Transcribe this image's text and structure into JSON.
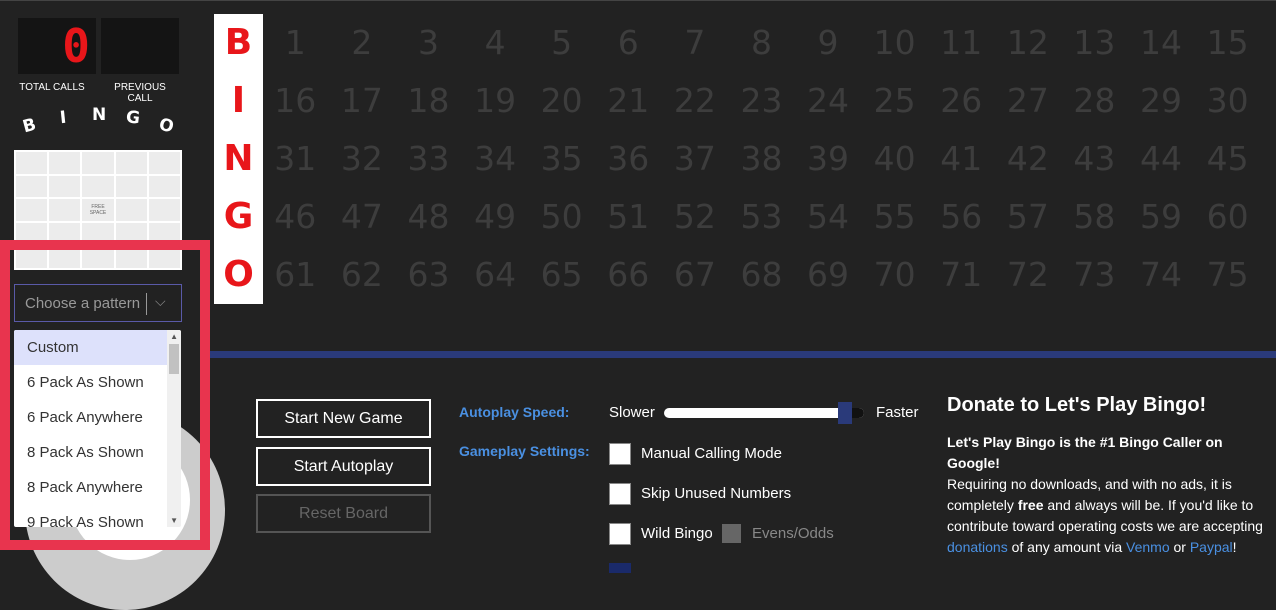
{
  "counters": {
    "total_value": "0",
    "total_label": "TOTAL CALLS",
    "previous_value": "",
    "previous_label": "PREVIOUS CALL"
  },
  "bingo_letters": [
    "B",
    "I",
    "N",
    "G",
    "O"
  ],
  "card": {
    "free_space": "FREE SPACE"
  },
  "pattern_select": {
    "placeholder": "Choose a pattern",
    "options": [
      "Custom",
      "6 Pack As Shown",
      "6 Pack Anywhere",
      "8 Pack As Shown",
      "8 Pack Anywhere",
      "9 Pack As Shown"
    ],
    "highlighted": "Custom"
  },
  "board": {
    "rows": [
      [
        "1",
        "2",
        "3",
        "4",
        "5",
        "6",
        "7",
        "8",
        "9",
        "10",
        "11",
        "12",
        "13",
        "14",
        "15"
      ],
      [
        "16",
        "17",
        "18",
        "19",
        "20",
        "21",
        "22",
        "23",
        "24",
        "25",
        "26",
        "27",
        "28",
        "29",
        "30"
      ],
      [
        "31",
        "32",
        "33",
        "34",
        "35",
        "36",
        "37",
        "38",
        "39",
        "40",
        "41",
        "42",
        "43",
        "44",
        "45"
      ],
      [
        "46",
        "47",
        "48",
        "49",
        "50",
        "51",
        "52",
        "53",
        "54",
        "55",
        "56",
        "57",
        "58",
        "59",
        "60"
      ],
      [
        "61",
        "62",
        "63",
        "64",
        "65",
        "66",
        "67",
        "68",
        "69",
        "70",
        "71",
        "72",
        "73",
        "74",
        "75"
      ]
    ]
  },
  "buttons": {
    "start_new_game": "Start New Game",
    "start_autoplay": "Start Autoplay",
    "reset_board": "Reset Board"
  },
  "settings": {
    "autoplay_speed_label": "Autoplay Speed:",
    "slower": "Slower",
    "faster": "Faster",
    "speed_level": 0.9,
    "gameplay_label": "Gameplay Settings:",
    "manual_calling": "Manual Calling Mode",
    "skip_unused": "Skip Unused Numbers",
    "wild_bingo": "Wild Bingo",
    "evens_odds": "Evens/Odds"
  },
  "donate": {
    "title": "Donate to Let's Play Bingo!",
    "lead": "Let's Play Bingo is the #1 Bingo Caller on Google!",
    "text1": "Requiring no downloads, and with no ads, it is completely ",
    "free": "free",
    "text2": " and always will be. If you'd like to contribute toward operating costs we are accepting ",
    "donations_link": "donations",
    "text3": " of any amount via ",
    "venmo_link": "Venmo",
    "text4": " or ",
    "paypal_link": "Paypal",
    "text5": "!"
  },
  "colors": {
    "accent_red": "#e8161a",
    "link_blue": "#4a90e2",
    "highlight_border": "#e8344e",
    "divider": "#2a3a7a"
  }
}
